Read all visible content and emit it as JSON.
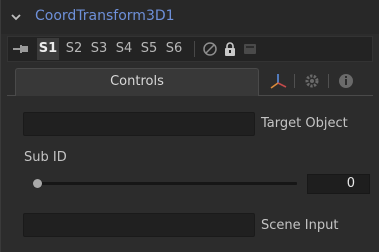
{
  "node": {
    "title": "CoordTransform3D1"
  },
  "versions": {
    "slots": [
      "S1",
      "S2",
      "S3",
      "S4",
      "S5",
      "S6"
    ],
    "active_slot": "S1",
    "icons": [
      "pin-icon",
      "disable-icon",
      "lock-icon",
      "cache-icon"
    ]
  },
  "tabs": {
    "controls_label": "Controls",
    "icons": [
      "transform-3d-icon",
      "gear-icon",
      "info-icon"
    ]
  },
  "controls": {
    "target_object": {
      "label": "Target Object",
      "value": ""
    },
    "sub_id": {
      "label": "Sub ID",
      "value": "0",
      "slider_fraction": 0
    },
    "scene_input": {
      "label": "Scene Input",
      "value": ""
    }
  },
  "colors": {
    "title": "#6e90d9",
    "panel_bg": "#2c2c2c",
    "field_bg": "#202020"
  }
}
